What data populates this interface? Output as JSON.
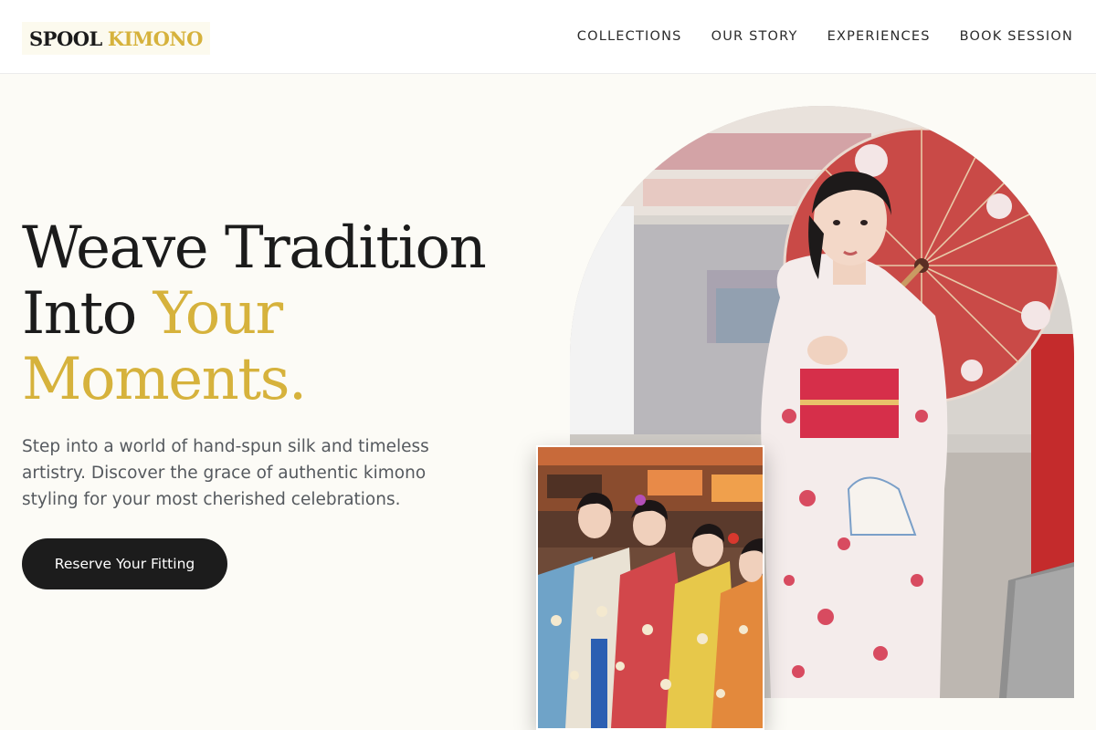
{
  "brand": {
    "word1": "SPOOL",
    "word2": "KIMONO"
  },
  "nav": {
    "collections": "COLLECTIONS",
    "our_story": "OUR STORY",
    "experiences": "EXPERIENCES",
    "book_session": "BOOK SESSION"
  },
  "hero": {
    "headline_line1": "Weave Tradition",
    "headline_line2_plain": "Into",
    "headline_line2_accent": "Your",
    "headline_line3_accent": "Moments.",
    "subtext": "Step into a world of hand-spun silk and timeless artistry. Discover the grace of authentic kimono styling for your most cherished celebrations.",
    "cta_label": "Reserve Your Fitting"
  },
  "images": {
    "main_photo": "woman-in-kimono-with-red-parasol",
    "secondary_photo": "group-of-women-in-kimonos"
  },
  "colors": {
    "accent_gold": "#d6b23c",
    "text_dark": "#1b1b1b",
    "text_muted": "#55595e",
    "background": "#fcfbf6",
    "button_bg": "#1c1c1c"
  }
}
